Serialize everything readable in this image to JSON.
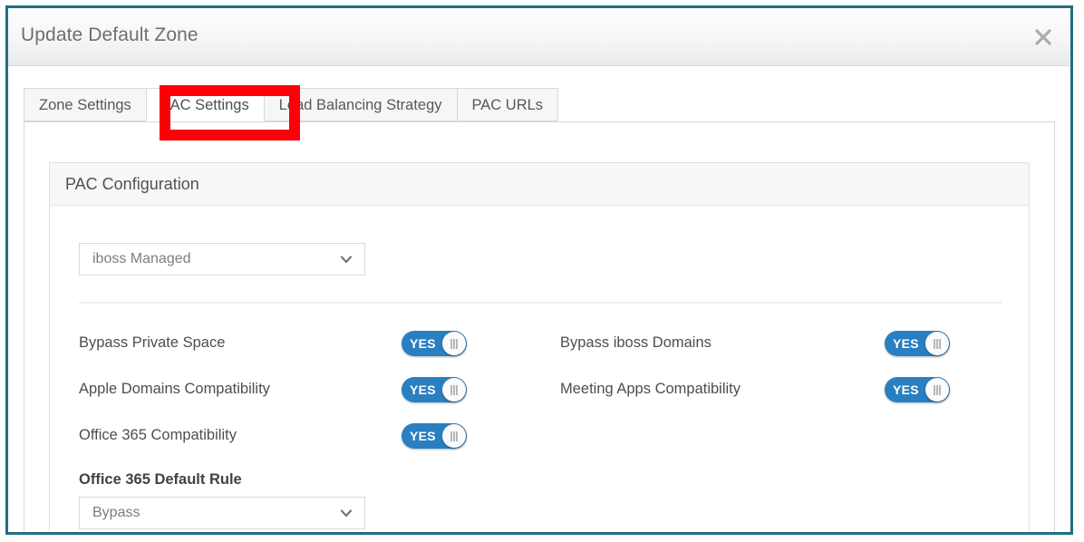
{
  "window": {
    "title": "Update Default Zone",
    "close_icon": "close-icon"
  },
  "tabs": [
    {
      "label": "Zone Settings",
      "active": false
    },
    {
      "label": "PAC Settings",
      "active": true
    },
    {
      "label": "Load Balancing Strategy",
      "active": false
    },
    {
      "label": "PAC URLs",
      "active": false
    }
  ],
  "card": {
    "title": "PAC Configuration",
    "pac_select": {
      "value": "iboss Managed",
      "arrow_icon": "chevron-down-icon"
    },
    "toggle_rows": [
      {
        "left": {
          "label": "Bypass Private Space",
          "toggle_label": "YES",
          "on": true
        },
        "right": {
          "label": "Bypass iboss Domains",
          "toggle_label": "YES",
          "on": true
        }
      },
      {
        "left": {
          "label": "Apple Domains Compatibility",
          "toggle_label": "YES",
          "on": true
        },
        "right": {
          "label": "Meeting Apps Compatibility",
          "toggle_label": "YES",
          "on": true
        }
      },
      {
        "left": {
          "label": "Office 365 Compatibility",
          "toggle_label": "YES",
          "on": true
        },
        "right": {
          "label": "",
          "toggle_label": "",
          "on": null
        }
      }
    ],
    "office_rule": {
      "label": "Office 365 Default Rule",
      "value": "Bypass",
      "arrow_icon": "chevron-down-icon"
    }
  },
  "annotation": {
    "target": "PAC Settings",
    "color": "#fb0007"
  },
  "colors": {
    "window_border": "#1f6e80",
    "toggle_on": "#2a7fc1",
    "annotation_red": "#fb0007",
    "title_text": "#6d6f72"
  }
}
